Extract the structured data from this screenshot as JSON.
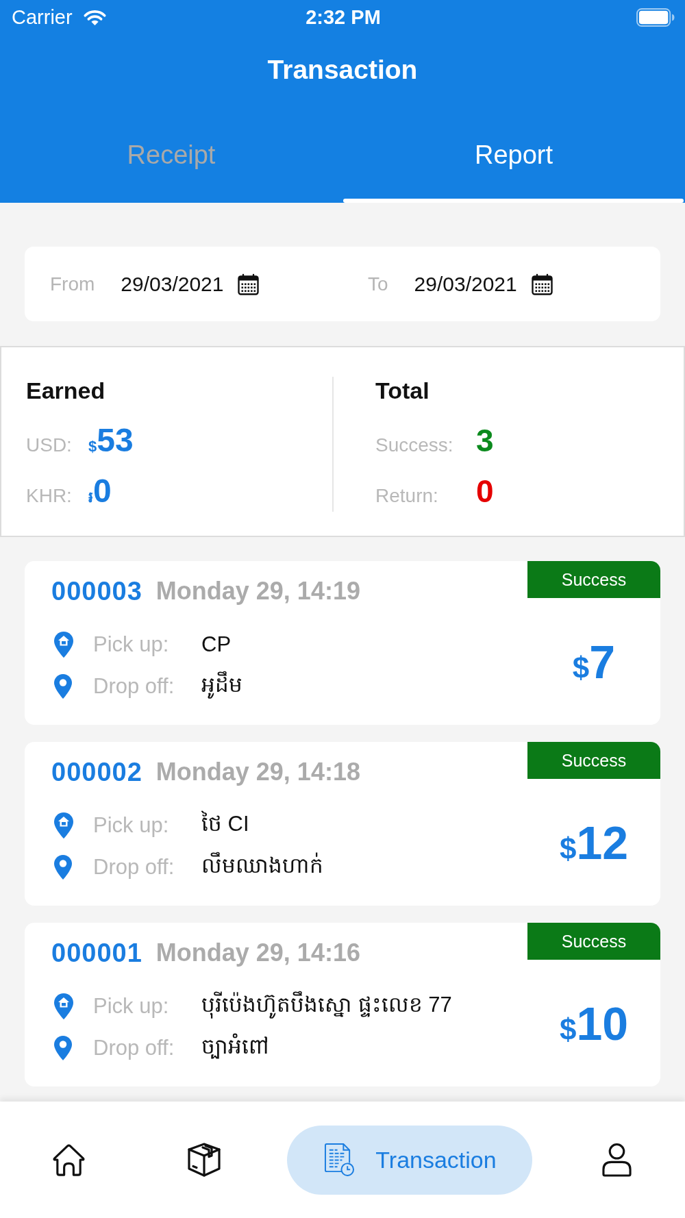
{
  "status_bar": {
    "carrier": "Carrier",
    "time": "2:32 PM"
  },
  "header": {
    "title": "Transaction"
  },
  "tabs": [
    {
      "label": "Receipt",
      "selected": false
    },
    {
      "label": "Report",
      "selected": true
    }
  ],
  "date_filter": {
    "from": {
      "label": "From",
      "value": "29/03/2021"
    },
    "to": {
      "label": "To",
      "value": "29/03/2021"
    }
  },
  "summary": {
    "earned": {
      "title": "Earned",
      "rows": [
        {
          "label": "USD:",
          "symbol": "$",
          "value": "53"
        },
        {
          "label": "KHR:",
          "symbol": "៛",
          "value": "0"
        }
      ]
    },
    "total": {
      "title": "Total",
      "rows": [
        {
          "label": "Success:",
          "value": "3",
          "color": "#0b8a1d"
        },
        {
          "label": "Return:",
          "value": "0",
          "color": "#e50000"
        }
      ]
    }
  },
  "transactions": [
    {
      "id": "000003",
      "date": "Monday 29, 14:19",
      "status": "Success",
      "pickup_label": "Pick up:",
      "pickup": "CP",
      "dropoff_label": "Drop off:",
      "dropoff": "អូដឹម",
      "currency": "$",
      "amount": "7"
    },
    {
      "id": "000002",
      "date": "Monday 29, 14:18",
      "status": "Success",
      "pickup_label": "Pick up:",
      "pickup": "ថៃ CI",
      "dropoff_label": "Drop off:",
      "dropoff": "លឹមឈាងហាក់",
      "currency": "$",
      "amount": "12"
    },
    {
      "id": "000001",
      "date": "Monday 29, 14:16",
      "status": "Success",
      "pickup_label": "Pick up:",
      "pickup": "បុរីប៉េងហ៊ូតបឹងស្នោ ផ្ទះលេខ 77",
      "dropoff_label": "Drop off:",
      "dropoff": "ច្បាអំពៅ",
      "currency": "$",
      "amount": "10"
    }
  ],
  "bottom_nav": {
    "items": [
      {
        "kind": "home",
        "selected": false
      },
      {
        "kind": "package",
        "selected": false
      },
      {
        "kind": "transaction",
        "label": "Transaction",
        "selected": true
      },
      {
        "kind": "profile",
        "selected": false
      }
    ]
  }
}
